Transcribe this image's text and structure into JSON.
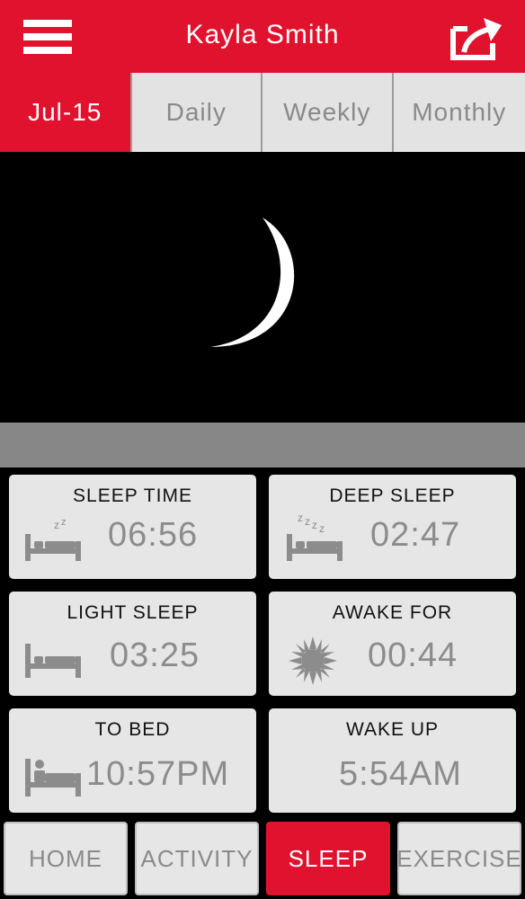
{
  "header": {
    "title": "Kayla Smith",
    "menu_icon": "hamburger-menu-icon",
    "share_icon": "share-export-icon"
  },
  "tabs": [
    {
      "label": "Jul-15",
      "active": true
    },
    {
      "label": "Daily",
      "active": false
    },
    {
      "label": "Weekly",
      "active": false
    },
    {
      "label": "Monthly",
      "active": false
    }
  ],
  "hero": {
    "icon": "crescent-moon-icon"
  },
  "stats": [
    {
      "label": "SLEEP TIME",
      "value": "06:56",
      "icon": "bed-zz-icon"
    },
    {
      "label": "DEEP SLEEP",
      "value": "02:47",
      "icon": "bed-zzzz-icon"
    },
    {
      "label": "LIGHT SLEEP",
      "value": "03:25",
      "icon": "bed-icon"
    },
    {
      "label": "AWAKE FOR",
      "value": "00:44",
      "icon": "sun-icon"
    },
    {
      "label": "TO BED",
      "value": "10:57PM",
      "icon": "person-in-bed-icon"
    },
    {
      "label": "WAKE UP",
      "value": "5:54AM",
      "icon": ""
    }
  ],
  "bottom_nav": [
    {
      "label": "HOME",
      "active": false
    },
    {
      "label": "ACTIVITY",
      "active": false
    },
    {
      "label": "SLEEP",
      "active": true
    },
    {
      "label": "EXERCISE",
      "active": false
    }
  ],
  "colors": {
    "brand_red": "#e0122d",
    "card_bg": "#e6e6e6",
    "value_gray": "#8c8c8c"
  }
}
